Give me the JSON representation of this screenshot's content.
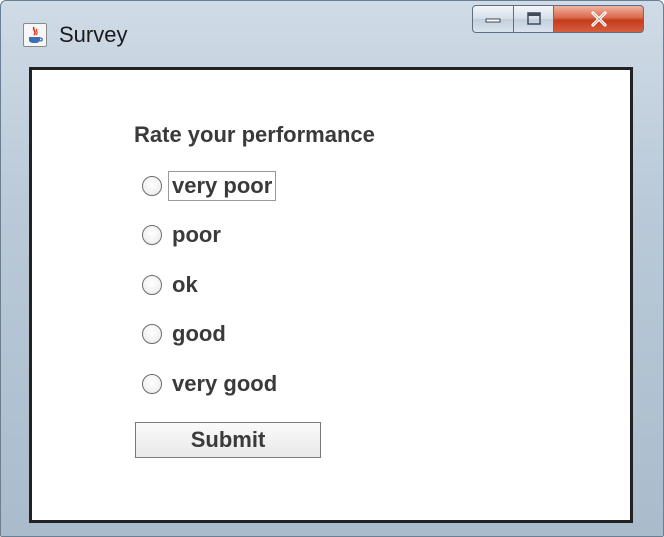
{
  "window": {
    "title": "Survey",
    "controls": {
      "minimize_icon": "minimize-icon",
      "maximize_icon": "maximize-icon",
      "close_icon": "close-icon",
      "close_color": "#c9432a"
    }
  },
  "form": {
    "heading": "Rate your performance",
    "options": [
      {
        "label": "very poor",
        "selected": false,
        "focused": true
      },
      {
        "label": "poor",
        "selected": false,
        "focused": false
      },
      {
        "label": "ok",
        "selected": false,
        "focused": false
      },
      {
        "label": "good",
        "selected": false,
        "focused": false
      },
      {
        "label": "very good",
        "selected": false,
        "focused": false
      }
    ],
    "submit_label": "Submit"
  }
}
